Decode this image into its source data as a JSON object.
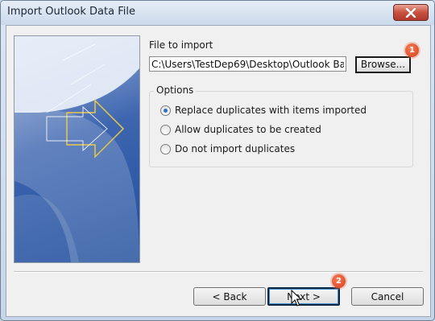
{
  "window": {
    "title": "Import Outlook Data File"
  },
  "file": {
    "label": "File to import",
    "path": "C:\\Users\\TestDep69\\Desktop\\Outlook Ba",
    "browse_label": "Browse..."
  },
  "options": {
    "title": "Options",
    "items": [
      {
        "label": "Replace duplicates with items imported",
        "checked": true
      },
      {
        "label": "Allow duplicates to be created",
        "checked": false
      },
      {
        "label": "Do not import duplicates",
        "checked": false
      }
    ]
  },
  "buttons": {
    "back": "< Back",
    "next": "Next >",
    "cancel": "Cancel"
  },
  "annotations": {
    "marker1": "1",
    "marker2": "2"
  },
  "colors": {
    "marker": "#e0562f",
    "banner_blue": "#2b59a8",
    "arrow_yellow": "#e8c84a"
  }
}
